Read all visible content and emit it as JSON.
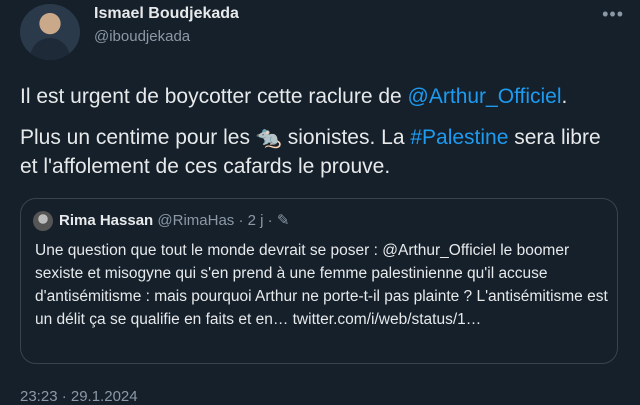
{
  "author": {
    "name": "Ismael Boudjekada",
    "handle": "@iboudjekada"
  },
  "tweet": {
    "line1_before": "Il est urgent de boycotter cette raclure de ",
    "line1_mention": "@Arthur_Officiel",
    "line1_after": ".",
    "line2_before": "Plus un centime pour les 🐀 sionistes. La ",
    "line2_hashtag": "#Palestine",
    "line2_after": " sera libre et l'affolement de ces cafards le prouve."
  },
  "quoted": {
    "name": "Rima Hassan",
    "handle": "@RimaHas",
    "age": "· 2 j ·",
    "text": "Une question que tout le monde devrait se poser : @Arthur_Officiel le boomer sexiste et misogyne qui s'en prend à une femme palestinienne qu'il accuse d'antisémitisme : mais pourquoi Arthur ne porte-t-il pas plainte ? L'antisémitisme est un délit ça se qualifie en faits et en… twitter.com/i/web/status/1…"
  },
  "more_icon": "more-horizontal-icon",
  "timestamp": "23:23 · 29.1.2024"
}
